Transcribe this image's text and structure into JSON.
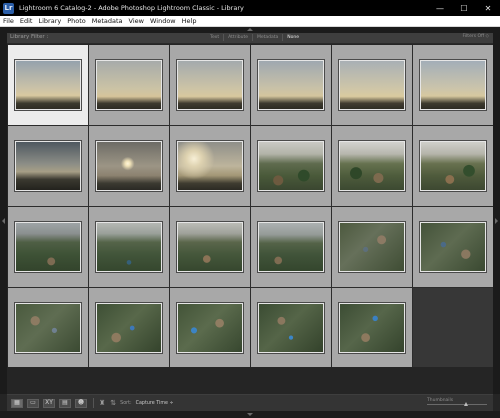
{
  "window": {
    "title": "Lightroom 6 Catalog-2 - Adobe Photoshop Lightroom Classic - Library",
    "app_icon": "Lr",
    "controls": {
      "minimize": "—",
      "maximize": "☐",
      "close": "✕"
    }
  },
  "menu": [
    "File",
    "Edit",
    "Library",
    "Photo",
    "Metadata",
    "View",
    "Window",
    "Help"
  ],
  "filterbar": {
    "title": "Library Filter :",
    "tabs": [
      "Text",
      "Attribute",
      "Metadata",
      "None"
    ],
    "active_tab": "None",
    "filters_off": "Filters Off ◇"
  },
  "grid": {
    "columns": 6,
    "selected_index": 0,
    "thumbnails": [
      "haze-sunrise-1",
      "haze-sunrise-2",
      "haze-sunrise-3",
      "haze-sunrise-4",
      "haze-sunrise-5",
      "haze-sunrise-6",
      "dark-horizon",
      "sun-in-haze",
      "bright-haze",
      "aerial-village-haze-1",
      "aerial-village-haze-2",
      "aerial-village-haze-3",
      "aerial-hills-1",
      "aerial-hills-2",
      "aerial-hills-3",
      "aerial-hills-4",
      "aerial-town-1",
      "aerial-town-2",
      "aerial-town-3",
      "aerial-town-4",
      "aerial-town-5",
      "aerial-town-6",
      "aerial-town-7"
    ]
  },
  "toolbar": {
    "buttons": [
      "grid-view",
      "loupe-view",
      "compare-view",
      "survey-view",
      "people-view"
    ],
    "sort_label": "Sort:",
    "sort_value": "Capture Time ÷",
    "thumbnails_label": "Thumbnails",
    "thumbnail_size": 0.65
  },
  "colors": {
    "cell": "#a8a8a8",
    "cell_selected": "#ececec",
    "background": "#252525"
  }
}
